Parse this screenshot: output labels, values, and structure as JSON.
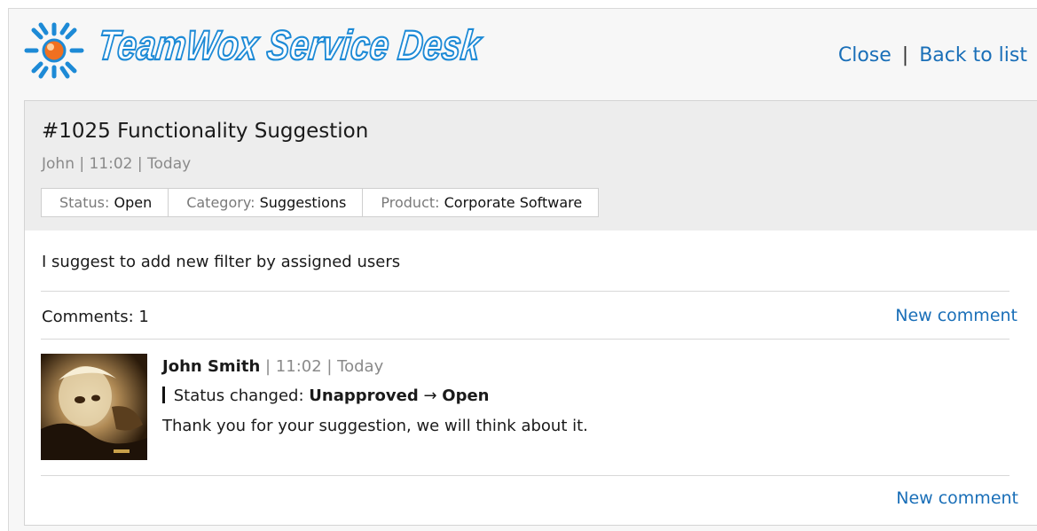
{
  "header": {
    "logo_text": "TeamWox Service Desk",
    "close_label": "Close",
    "separator": "|",
    "back_label": "Back to list"
  },
  "ticket": {
    "title": "#1025 Functionality Suggestion",
    "meta": "John | 11:02 | Today",
    "status_key": "Status:",
    "status_value": "Open",
    "category_key": "Category:",
    "category_value": "Suggestions",
    "product_key": "Product:",
    "product_value": "Corporate Software",
    "body": "I suggest to add new filter by assigned users"
  },
  "comments": {
    "count_label": "Comments: 1",
    "new_comment_label": "New comment",
    "items": [
      {
        "author": "John Smith",
        "meta": "| 11:02 | Today",
        "status_prefix": "Status changed:",
        "status_from": "Unapproved",
        "arrow": "→",
        "status_to": "Open",
        "text": "Thank you for your suggestion, we will think about it."
      }
    ]
  },
  "colors": {
    "link": "#1a6fb8",
    "logo_blue": "#1d8ad6",
    "logo_orange": "#f07020",
    "header_bg": "#ededed"
  }
}
